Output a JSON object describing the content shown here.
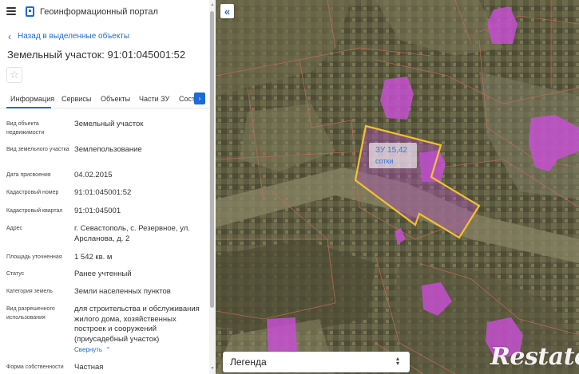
{
  "header": {
    "title": "Геоинформационный портал",
    "menu_icon": "hamburger-icon",
    "logo_icon": "portal-logo-icon"
  },
  "back_link": {
    "label": "Назад в выделенные объекты"
  },
  "object": {
    "title": "Земельный участок: 91:01:045001:52"
  },
  "favorite": {
    "icon": "star-icon",
    "glyph": "☆"
  },
  "tabs": [
    {
      "label": "Информация",
      "active": true
    },
    {
      "label": "Сервисы",
      "active": false
    },
    {
      "label": "Объекты",
      "active": false
    },
    {
      "label": "Части ЗУ",
      "active": false
    },
    {
      "label": "Сост",
      "active": false
    }
  ],
  "tab_next_glyph": "›",
  "properties": [
    {
      "label": "Вид объекта недвижимости",
      "value": "Земельный участок"
    },
    {
      "label": "Вид земельного участка",
      "value": "Землепользование"
    },
    {
      "label": "Дата присвоения",
      "value": "04.02.2015"
    },
    {
      "label": "Кадастровый номер",
      "value": "91:01:045001:52"
    },
    {
      "label": "Кадастровый квартал",
      "value": "91:01:045001"
    },
    {
      "label": "Адрес",
      "value": "г. Севастополь, с. Резервное, ул. Арсланова, д. 2"
    },
    {
      "label": "Площадь уточненная",
      "value": "1 542 кв. м"
    },
    {
      "label": "Статус",
      "value": "Ранее учтенный"
    },
    {
      "label": "Категория земель",
      "value": "Земли населенных пунктов"
    },
    {
      "label": "Вид разрешенного использования",
      "value": "для строительства и обслуживания жилого дома, хозяйственных построек и сооружений (приусадебный участок)"
    },
    {
      "label": "Форма собственности",
      "value": "Частная"
    }
  ],
  "collapse": {
    "label": "Свернуть",
    "glyph": "⌃"
  },
  "map": {
    "collapse_button_glyph": "«",
    "parcel_label": {
      "line1": "ЗУ 15,42",
      "line2": "сотки"
    },
    "parcel_outline_color": "#f2c12e",
    "building_color": "#c94fd6",
    "legend": {
      "label": "Легенда",
      "arrows": "⌃⌄"
    },
    "watermark": "Restate"
  },
  "colors": {
    "accent": "#1e6ad6"
  }
}
